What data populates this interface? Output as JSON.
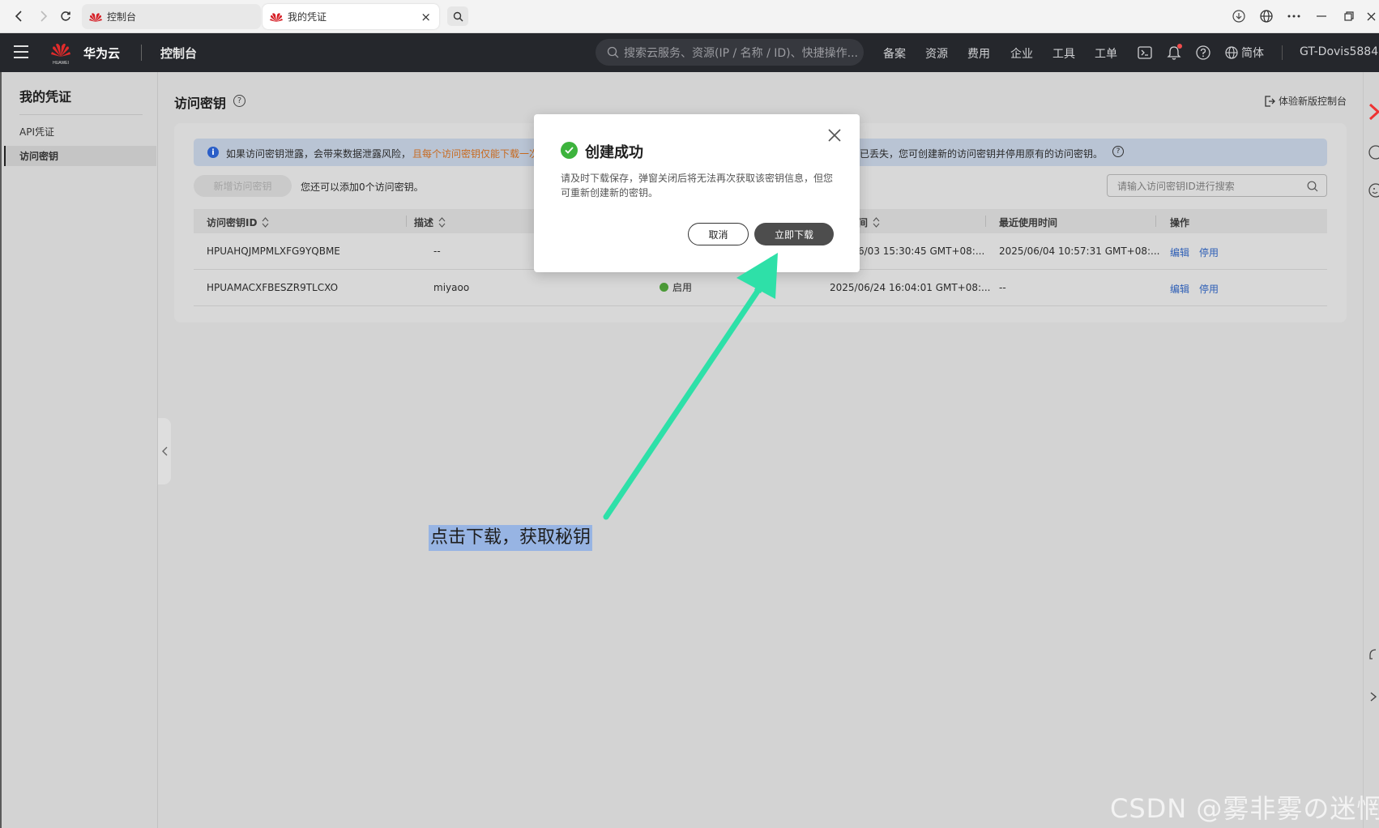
{
  "browser": {
    "tabs": [
      {
        "title": "控制台"
      },
      {
        "title": "我的凭证"
      }
    ],
    "close_glyph": "×"
  },
  "header": {
    "brand": "华为云",
    "logo_text": "HUAWEI",
    "console": "控制台",
    "search_placeholder": "搜索云服务、资源(IP / 名称 / ID)、快捷操作...",
    "nav": [
      "备案",
      "资源",
      "费用",
      "企业",
      "工具",
      "工单"
    ],
    "language": "简体",
    "user": "GT-Dovis5884"
  },
  "sidebar": {
    "title": "我的凭证",
    "items": [
      {
        "label": "API凭证",
        "active": false
      },
      {
        "label": "访问密钥",
        "active": true
      }
    ]
  },
  "main": {
    "title": "访问密钥",
    "new_console": "体验新版控制台",
    "notice": {
      "part1": "如果访问密钥泄露，会带来数据泄露风险，",
      "part2": "且每个访问密钥仅能下载一次",
      "part3": "已丢失，您可创建新的访问密钥并停用原有的访问密钥。"
    },
    "new_key_button": "新增访问密钥",
    "can_add_text": "您还可以添加0个访问密钥。",
    "search_placeholder": "请输入访问密钥ID进行搜索",
    "columns": [
      "访问密钥ID",
      "描述",
      "间",
      "最近使用时间",
      "操作"
    ],
    "rows": [
      {
        "id": "HPUAHQJMPMLXFG9YQBME",
        "desc": "--",
        "status": "",
        "created": "6/03 15:30:45 GMT+08:...",
        "last_used": "2025/06/04 10:57:31 GMT+08:...",
        "edit": "编辑",
        "disable": "停用"
      },
      {
        "id": "HPUAMACXFBESZR9TLCXO",
        "desc": "miyaoo",
        "status": "启用",
        "created": "2025/06/24 16:04:01 GMT+08:...",
        "last_used": "--",
        "edit": "编辑",
        "disable": "停用"
      }
    ]
  },
  "modal": {
    "title": "创建成功",
    "body": "请及时下载保存，弹窗关闭后将无法再次获取该密钥信息，但您可重新创建新的密钥。",
    "cancel": "取消",
    "download": "立即下载"
  },
  "annotation": {
    "text": "点击下载，获取秘钥",
    "arrow_color": "#2ee0a8"
  },
  "watermark": "CSDN @雾非雾の迷惘",
  "colors": {
    "header_bg": "#25272c",
    "link": "#2d5eb6",
    "notice_highlight": "#c86a1f",
    "success": "#3db33d",
    "primary_button": "#4d4d4d"
  }
}
